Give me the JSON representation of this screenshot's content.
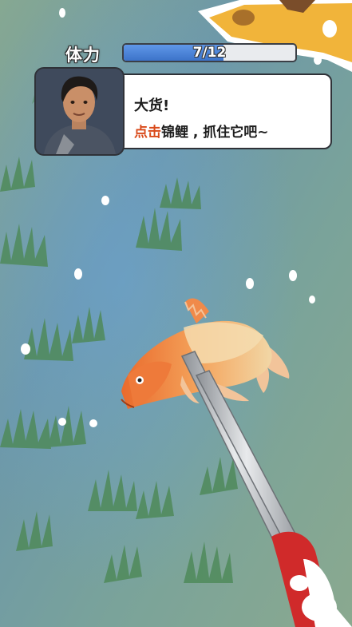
{
  "hud": {
    "stamina_label": "体力",
    "stamina_text": "7/12",
    "stamina_fraction": 0.583
  },
  "dialog": {
    "line1": "大货!",
    "line2_highlight": "点击",
    "line2_rest": "锦鲤 , 抓住它吧~"
  },
  "colors": {
    "highlight": "#d94a1a",
    "stamina_fill": "#4a82d8",
    "water": "#6f9a8e"
  },
  "icons": {
    "portrait": "character-portrait-icon",
    "fish": "koi-fish-icon",
    "tongs": "fishing-tongs-icon",
    "cheese": "cheese-icon"
  }
}
